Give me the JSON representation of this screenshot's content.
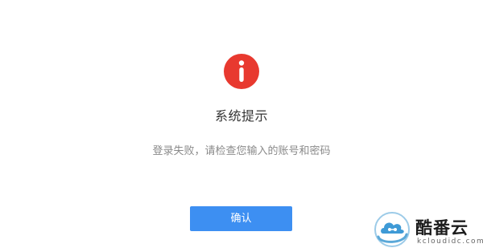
{
  "dialog": {
    "icon": "info-icon",
    "icon_color": "#e8392f",
    "title": "系统提示",
    "message": "登录失败，请检查您输入的账号和密码",
    "confirm_label": "确认",
    "button_color": "#3d8ff2"
  },
  "watermark": {
    "name": "酷番云",
    "domain": "kcloudidc.com",
    "logo_icon": "cloud-logo-icon"
  }
}
